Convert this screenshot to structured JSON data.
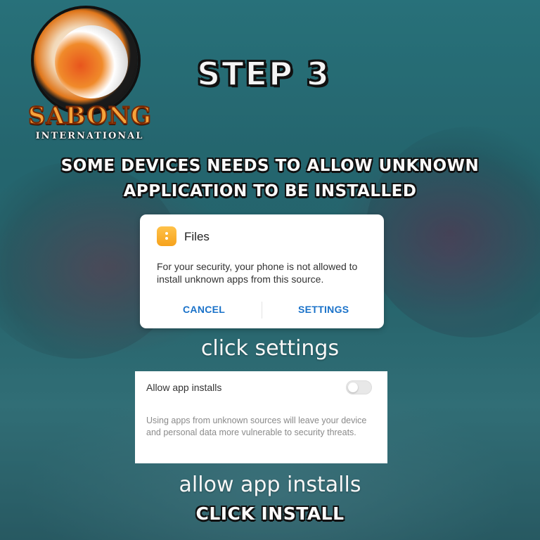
{
  "logo": {
    "name": "SABONG",
    "subtitle": "INTERNATIONAL",
    "icon": "rooster-logo-icon"
  },
  "heading": {
    "step": "STEP 3",
    "warning_line1": "SOME DEVICES NEEDS TO ALLOW UNKNOWN",
    "warning_line2": "APPLICATION TO BE INSTALLED"
  },
  "dialog": {
    "icon": "files-app-icon",
    "title": "Files",
    "body": "For your security, your phone is not allowed to install unknown apps from this source.",
    "cancel_label": "CANCEL",
    "settings_label": "SETTINGS"
  },
  "captions": {
    "click_settings": "click settings",
    "allow_app_installs": "allow app installs",
    "click_install": "CLICK INSTALL"
  },
  "settings_panel": {
    "label": "Allow app installs",
    "toggle_state": "off",
    "note": "Using apps from unknown sources will leave your device and personal data more vulnerable to security threats."
  },
  "colors": {
    "background_teal": "#2f7f88",
    "button_blue": "#1a72c9",
    "logo_orange": "#f6a33a"
  }
}
